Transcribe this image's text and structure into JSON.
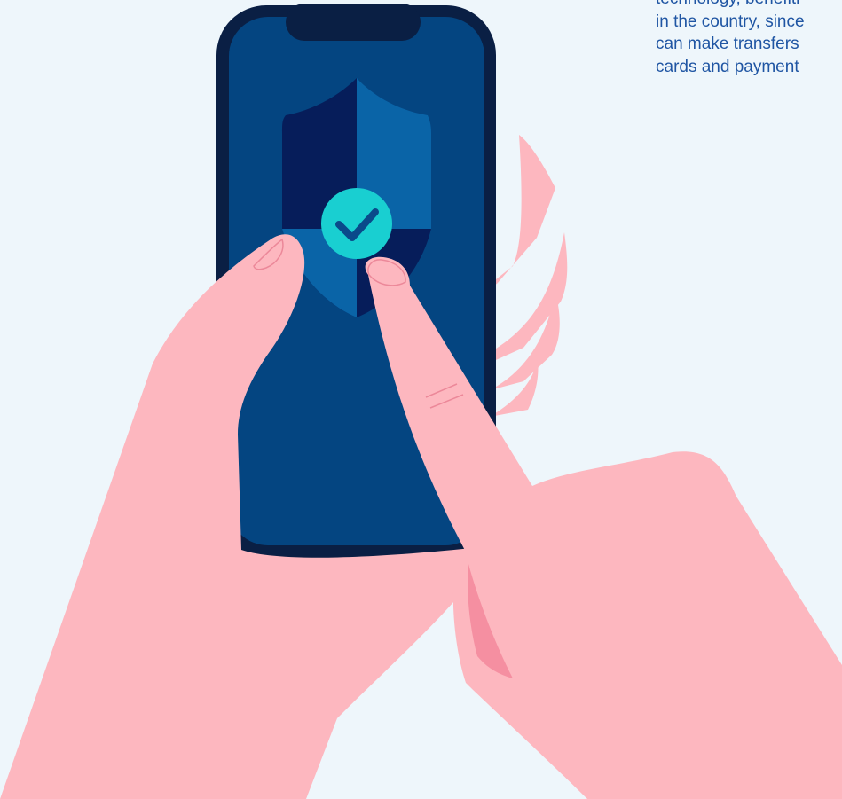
{
  "text_lines": [
    "technology, benefiti",
    "in the country, since",
    "can make transfers",
    "cards and payment"
  ],
  "colors": {
    "background": "#eef6fb",
    "text": "#1f55a3",
    "phone_frame": "#0a1f44",
    "phone_screen": "#044581",
    "shield_dark": "#061d5a",
    "shield_light": "#0a64a7",
    "check_circle": "#19cfd1",
    "check_mark": "#0a4a8a",
    "skin": "#fdb7bf",
    "skin_shadow": "#f58fa1",
    "nail_stroke": "#ec8899"
  },
  "icons": {
    "shield": "shield-check-icon",
    "check": "check-icon"
  }
}
